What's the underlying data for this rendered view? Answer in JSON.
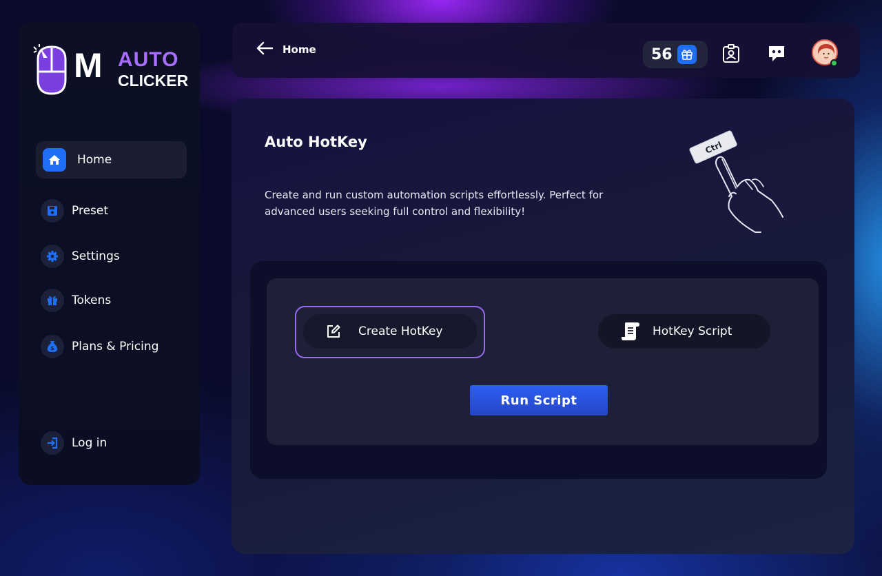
{
  "brand": {
    "logo_main": "M",
    "logo_top": "AUTO",
    "logo_bottom": "CLICKER"
  },
  "sidebar": {
    "items": [
      {
        "label": "Home",
        "icon": "home-icon",
        "active": true
      },
      {
        "label": "Preset",
        "icon": "save-icon"
      },
      {
        "label": "Settings",
        "icon": "gear-icon"
      },
      {
        "label": "Tokens",
        "icon": "gift-icon"
      },
      {
        "label": "Plans & Pricing",
        "icon": "money-bag-icon"
      }
    ],
    "login_label": "Log in"
  },
  "topbar": {
    "back_label": "Home",
    "coins": "56"
  },
  "main": {
    "title": "Auto HotKey",
    "description": "Create and run custom automation scripts effortlessly. Perfect for advanced users seeking full control and flexibility!",
    "illustration_key": "Ctrl",
    "create_label": "Create HotKey",
    "script_label": "HotKey Script",
    "run_label": "Run Script"
  },
  "colors": {
    "accent_blue": "#1e6ff5",
    "accent_purple": "#9b6af5",
    "run_button": "#2c5ff0",
    "online": "#35c759"
  }
}
